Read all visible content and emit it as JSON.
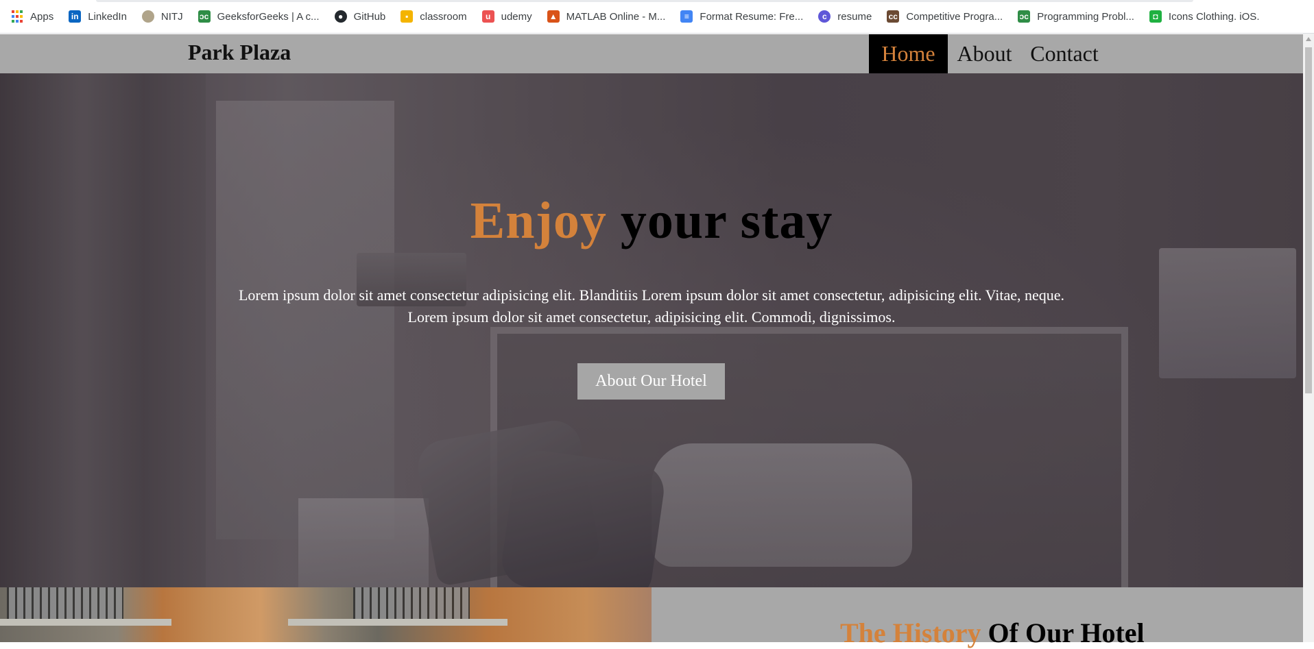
{
  "bookmarks": [
    {
      "label": "Apps",
      "icon": "apps-grid-icon"
    },
    {
      "label": "LinkedIn",
      "icon": "linkedin-icon",
      "icon_glyph": "in",
      "color": "#0a66c2"
    },
    {
      "label": "NITJ",
      "icon": "nitj-logo-icon",
      "icon_glyph": "",
      "color": "#b0a48a"
    },
    {
      "label": "GeeksforGeeks | A c...",
      "icon": "geeksforgeeks-icon",
      "icon_glyph": "ↄc",
      "color": "#2f8d46"
    },
    {
      "label": "GitHub",
      "icon": "github-icon",
      "icon_glyph": "●",
      "color": "#24292e"
    },
    {
      "label": "classroom",
      "icon": "classroom-icon",
      "icon_glyph": "▪",
      "color": "#f4b400"
    },
    {
      "label": "udemy",
      "icon": "udemy-icon",
      "icon_glyph": "u",
      "color": "#ec5252"
    },
    {
      "label": "MATLAB Online - M...",
      "icon": "matlab-icon",
      "icon_glyph": "▲",
      "color": "#d95319"
    },
    {
      "label": "Format Resume: Fre...",
      "icon": "document-icon",
      "icon_glyph": "≡",
      "color": "#4285f4"
    },
    {
      "label": "resume",
      "icon": "resume-c-icon",
      "icon_glyph": "c",
      "color": "#5f57d8"
    },
    {
      "label": "Competitive Progra...",
      "icon": "codechef-icon",
      "icon_glyph": "cc",
      "color": "#6b4a33"
    },
    {
      "label": "Programming Probl...",
      "icon": "geeksforgeeks-icon",
      "icon_glyph": "ↄc",
      "color": "#2f8d46"
    },
    {
      "label": "Icons Clothing. iOS.",
      "icon": "icons8-icon",
      "icon_glyph": "◘",
      "color": "#1fb141"
    }
  ],
  "navbar": {
    "brand": "Park Plaza",
    "links": {
      "home": "Home",
      "about": "About",
      "contact": "Contact"
    },
    "active": "Home"
  },
  "hero": {
    "title_accent": "Enjoy",
    "title_rest": " your stay",
    "text_line1": "Lorem ipsum dolor sit amet consectetur adipisicing elit. Blanditiis Lorem ipsum dolor sit amet consectetur, adipisicing elit. Vitae, neque.",
    "text_line2": "Lorem ipsum dolor sit amet consectetur, adipisicing elit. Commodi, dignissimos.",
    "button_label": "About Our Hotel"
  },
  "history": {
    "title_accent": "The History",
    "title_rest": " Of Our Hotel"
  },
  "colors": {
    "accent": "#d4823b",
    "navbar_bg": "#a8a8a8",
    "active_nav_bg": "#000000",
    "button_bg": "#a6a6a6"
  }
}
